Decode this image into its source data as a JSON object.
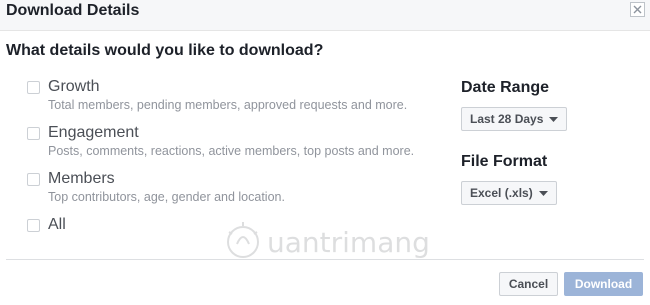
{
  "dialog": {
    "title": "Download Details",
    "close_icon": "close-icon"
  },
  "question": "What details would you like to download?",
  "options": [
    {
      "label": "Growth",
      "description": "Total members, pending members, approved requests and more.",
      "checked": false
    },
    {
      "label": "Engagement",
      "description": "Posts, comments, reactions, active members, top posts and more.",
      "checked": false
    },
    {
      "label": "Members",
      "description": "Top contributors, age, gender and location.",
      "checked": false
    },
    {
      "label": "All",
      "checked": false
    }
  ],
  "date_range": {
    "title": "Date Range",
    "selected": "Last 28 Days"
  },
  "file_format": {
    "title": "File Format",
    "selected": "Excel (.xls)"
  },
  "footer": {
    "cancel_label": "Cancel",
    "download_label": "Download"
  },
  "colors": {
    "primary_disabled": "#9cb4d8",
    "text_dark": "#1d2129",
    "text_muted": "#90949c"
  }
}
